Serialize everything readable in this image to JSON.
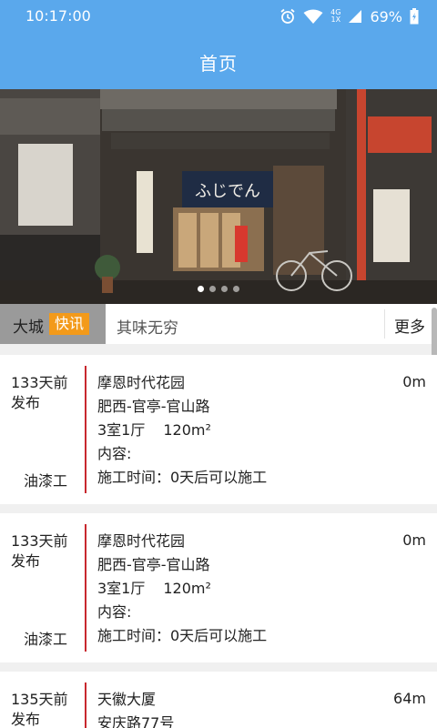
{
  "status": {
    "time": "10:17:00",
    "battery": "69%",
    "net_top": "4G",
    "net_bottom": "1X"
  },
  "header": {
    "title": "首页"
  },
  "banner": {
    "slides": 4,
    "active_index": 0,
    "shop_sign": "ふじでん"
  },
  "news": {
    "city": "大城",
    "tag": "快讯",
    "headline": "其味无穷",
    "more": "更多"
  },
  "listings": [
    {
      "ago": "133天前发布",
      "trade": "油漆工",
      "name": "摩恩时代花园",
      "distance": "0m",
      "area": "肥西-官亭-官山路",
      "rooms": "3室1厅",
      "size": "120m²",
      "content_label": "内容:",
      "schedule": "施工时间：0天后可以施工"
    },
    {
      "ago": "133天前发布",
      "trade": "油漆工",
      "name": "摩恩时代花园",
      "distance": "0m",
      "area": "肥西-官亭-官山路",
      "rooms": "3室1厅",
      "size": "120m²",
      "content_label": "内容:",
      "schedule": "施工时间：0天后可以施工"
    },
    {
      "ago": "135天前发布",
      "name": "天徽大厦",
      "distance": "64m",
      "area": "安庆路77号"
    }
  ],
  "colors": {
    "header": "#5aa8ec",
    "tag": "#f39a1a",
    "divider": "#c8282e"
  }
}
